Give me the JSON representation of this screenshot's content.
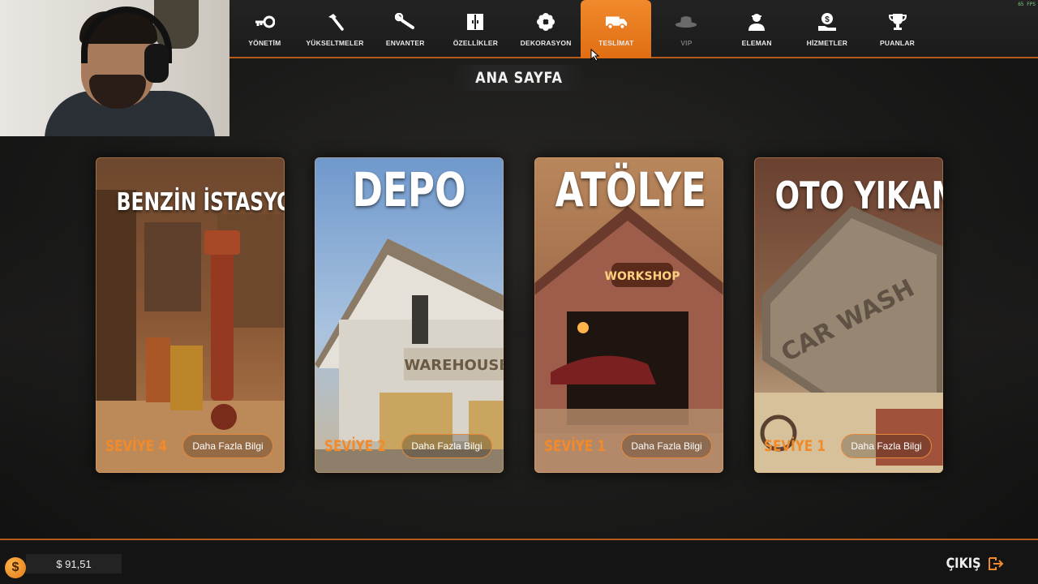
{
  "fps_overlay": "65 FPS",
  "nav": {
    "items": [
      {
        "label": "YÖNETİM",
        "icon": "key-icon",
        "state": "normal"
      },
      {
        "label": "YÜKSELTMELER",
        "icon": "hammer-icon",
        "state": "normal"
      },
      {
        "label": "ENVANTER",
        "icon": "wrench-icon",
        "state": "normal"
      },
      {
        "label": "ÖZELLİKLER",
        "icon": "cabinet-icon",
        "state": "normal"
      },
      {
        "label": "DEKORASYON",
        "icon": "flower-icon",
        "state": "normal"
      },
      {
        "label": "TESLİMAT",
        "icon": "truck-icon",
        "state": "active"
      },
      {
        "label": "VIP",
        "icon": "hat-icon",
        "state": "disabled"
      },
      {
        "label": "ELEMAN",
        "icon": "worker-icon",
        "state": "normal"
      },
      {
        "label": "HİZMETLER",
        "icon": "money-hand-icon",
        "state": "normal"
      },
      {
        "label": "PUANLAR",
        "icon": "trophy-icon",
        "state": "normal"
      }
    ]
  },
  "page_title": "ANA SAYFA",
  "cards": [
    {
      "title": "BENZİN İSTASYONU",
      "level": "SEVİYE 4",
      "button": "Daha Fazla Bilgi"
    },
    {
      "title": "DEPO",
      "level": "SEVİYE 2",
      "button": "Daha Fazla Bilgi",
      "sign": "WAREHOUSE"
    },
    {
      "title": "ATÖLYE",
      "level": "SEVİYE 1",
      "button": "Daha Fazla Bilgi",
      "sign": "WORKSHOP"
    },
    {
      "title": "OTO YIKAMA",
      "level": "SEVİYE 1",
      "button": "Daha Fazla Bilgi",
      "sign": "CAR WASH"
    }
  ],
  "footer": {
    "currency_symbol": "$",
    "balance": "$ 91,51",
    "exit_label": "ÇIKIŞ"
  },
  "colors": {
    "accent": "#f08a2c",
    "accent_dark": "#b85a17",
    "level_text": "#f28a2a"
  }
}
